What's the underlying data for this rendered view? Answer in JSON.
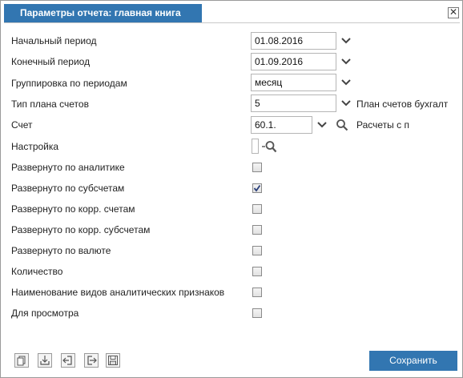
{
  "dialog": {
    "title": "Параметры отчета: главная книга",
    "close_glyph": "✕"
  },
  "fields": {
    "start_period": {
      "label": "Начальный период",
      "value": "01.08.2016"
    },
    "end_period": {
      "label": "Конечный период",
      "value": "01.09.2016"
    },
    "grouping": {
      "label": "Группировка по периодам",
      "value": "месяц"
    },
    "plan_type": {
      "label": "Тип плана счетов",
      "value": "5",
      "side_text": "План счетов бухгалт"
    },
    "account": {
      "label": "Счет",
      "value": "60.1.",
      "side_text": "Расчеты с п"
    },
    "settings": {
      "label": "Настройка"
    }
  },
  "checkboxes": [
    {
      "label": "Развернуто по аналитике",
      "checked": false
    },
    {
      "label": "Развернуто по субсчетам",
      "checked": true
    },
    {
      "label": "Развернуто по корр. счетам",
      "checked": false
    },
    {
      "label": "Развернуто по корр. субсчетам",
      "checked": false
    },
    {
      "label": "Развернуто по валюте",
      "checked": false
    },
    {
      "label": "Количество",
      "checked": false
    },
    {
      "label": "Наименование видов аналитических признаков",
      "checked": false
    },
    {
      "label": "Для просмотра",
      "checked": false
    }
  ],
  "toolbar": {
    "icons": [
      "copy-icon",
      "import-icon",
      "back-icon",
      "export-icon",
      "save-disk-icon"
    ],
    "save_label": "Сохранить"
  },
  "colors": {
    "accent": "#3276b1"
  }
}
